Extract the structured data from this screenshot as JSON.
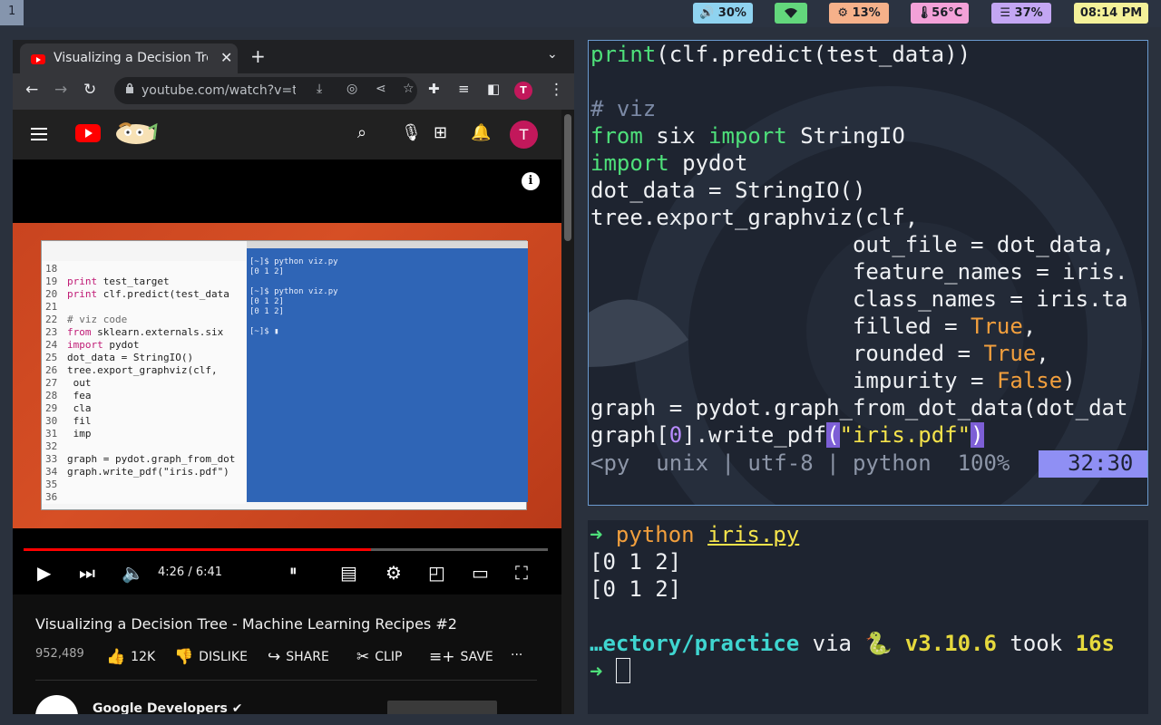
{
  "topbar": {
    "workspace": "1",
    "volume": "🔊 30%",
    "wifi": "wifi",
    "cpu": "⚙ 13%",
    "temp": "🌡56°C",
    "mem": "☰ 37%",
    "clock": "08:14 PM",
    "colors": {
      "volume": "#8fd3f0",
      "wifi": "#63d77c",
      "cpu": "#f6b18a",
      "temp": "#f3a1d8",
      "mem": "#c3a6f3",
      "clock": "#f4f199"
    }
  },
  "browser": {
    "tab_title": "Visualizing a Decision Tree",
    "close_glyph": "✕",
    "new_tab_glyph": "+",
    "tab_menu_glyph": "⌄",
    "url": "youtube.com/watch?v=t...",
    "profile_initial": "T",
    "youtube": {
      "avatar_initial": "T",
      "player": {
        "time": "4:26 / 6:41",
        "progress_fraction": 0.663,
        "slide_code": [
          {
            "n": "18",
            "t": ""
          },
          {
            "n": "19",
            "k": "print",
            "t": " test_target"
          },
          {
            "n": "20",
            "k": "print",
            "t": " clf.predict(test_data"
          },
          {
            "n": "21",
            "t": ""
          },
          {
            "n": "22",
            "t": "# viz code"
          },
          {
            "n": "23",
            "k": "from",
            "t": " sklearn.externals.six"
          },
          {
            "n": "24",
            "k": "import",
            "t": " pydot"
          },
          {
            "n": "25",
            "t": "dot_data = StringIO()"
          },
          {
            "n": "26",
            "t": "tree.export_graphviz(clf,"
          },
          {
            "n": "27",
            "t": "                        out"
          },
          {
            "n": "28",
            "t": "                        fea"
          },
          {
            "n": "29",
            "t": "                        cla"
          },
          {
            "n": "30",
            "t": "                        fil"
          },
          {
            "n": "31",
            "t": "                        imp"
          },
          {
            "n": "32",
            "t": ""
          },
          {
            "n": "33",
            "t": "graph = pydot.graph_from_dot"
          },
          {
            "n": "34",
            "t": "graph.write_pdf(\"iris.pdf\")"
          },
          {
            "n": "35",
            "t": ""
          },
          {
            "n": "36",
            "t": ""
          }
        ],
        "slide_terminal": [
          "[~]$ python viz.py",
          "[0 1 2]",
          "",
          "[~]$ python viz.py",
          "[0 1 2]",
          "[0 1 2]",
          "",
          "[~]$ ▮"
        ]
      },
      "video_title": "Visualizing a Decision Tree - Machine Learning Recipes #2",
      "views": "952,489",
      "likes": "12K",
      "dislike": "DISLIKE",
      "share": "SHARE",
      "clip": "CLIP",
      "save": "SAVE",
      "more": "···",
      "channel": "Google Developers ✔"
    }
  },
  "editor": {
    "lines": [
      "print(clf.predict(test_data))",
      "",
      "# viz",
      "from six import StringIO",
      "import pydot",
      "dot_data = StringIO()",
      "tree.export_graphviz(clf,",
      "                    out_file = dot_data,",
      "                    feature_names = iris.",
      "                    class_names = iris.ta",
      "                    filled = True,",
      "                    rounded = True,",
      "                    impurity = False)",
      "graph = pydot.graph_from_dot_data(dot_dat",
      "graph[0].write_pdf(\"iris.pdf\")"
    ],
    "status_left": "<py  unix | utf-8 | python  100%",
    "status_right": " 32:30"
  },
  "terminal": {
    "prompt_glyph": "➜",
    "command": "python",
    "arg": "iris.py",
    "out1": "[0 1 2]",
    "out2": "[0 1 2]",
    "dir": "…ectory/practice",
    "via": " via ",
    "py_icon": "🐍",
    "py_version": " v3.10.6",
    "took": " took ",
    "duration": "16s"
  }
}
